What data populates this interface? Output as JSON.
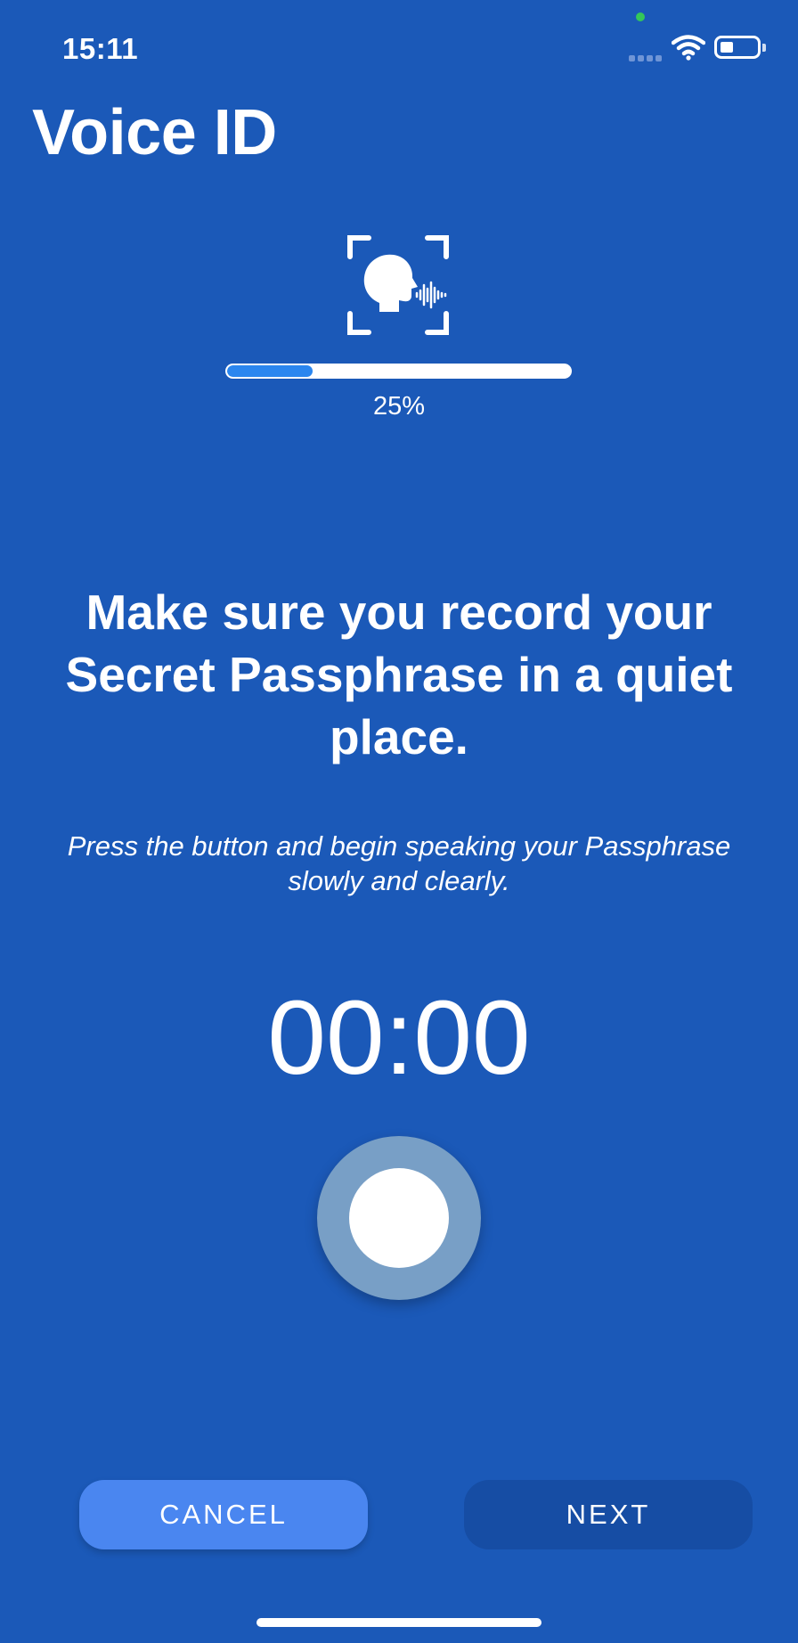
{
  "status_bar": {
    "time": "15:11",
    "icons": [
      "camera-indicator-dot",
      "cellular-signal-icon",
      "wifi-icon",
      "battery-icon"
    ],
    "battery_level": 0.35
  },
  "header": {
    "title": "Voice ID"
  },
  "enrollment": {
    "icon": "voice-scan-icon",
    "progress_value": 0.25,
    "progress_text": "25%"
  },
  "main": {
    "headline": "Make sure you record your Secret Passphrase in a quiet place.",
    "instruction": "Press the button and begin speaking your Passphrase slowly and clearly.",
    "timer": "00:00",
    "record_icon": "record-icon"
  },
  "actions": {
    "cancel_label": "CANCEL",
    "next_label": "NEXT"
  },
  "colors": {
    "background": "#1b59b8",
    "progress_fill": "#2a86ef",
    "cancel_button": "#4a86f0",
    "next_button": "#164da4",
    "record_ring": "#789fc6"
  }
}
